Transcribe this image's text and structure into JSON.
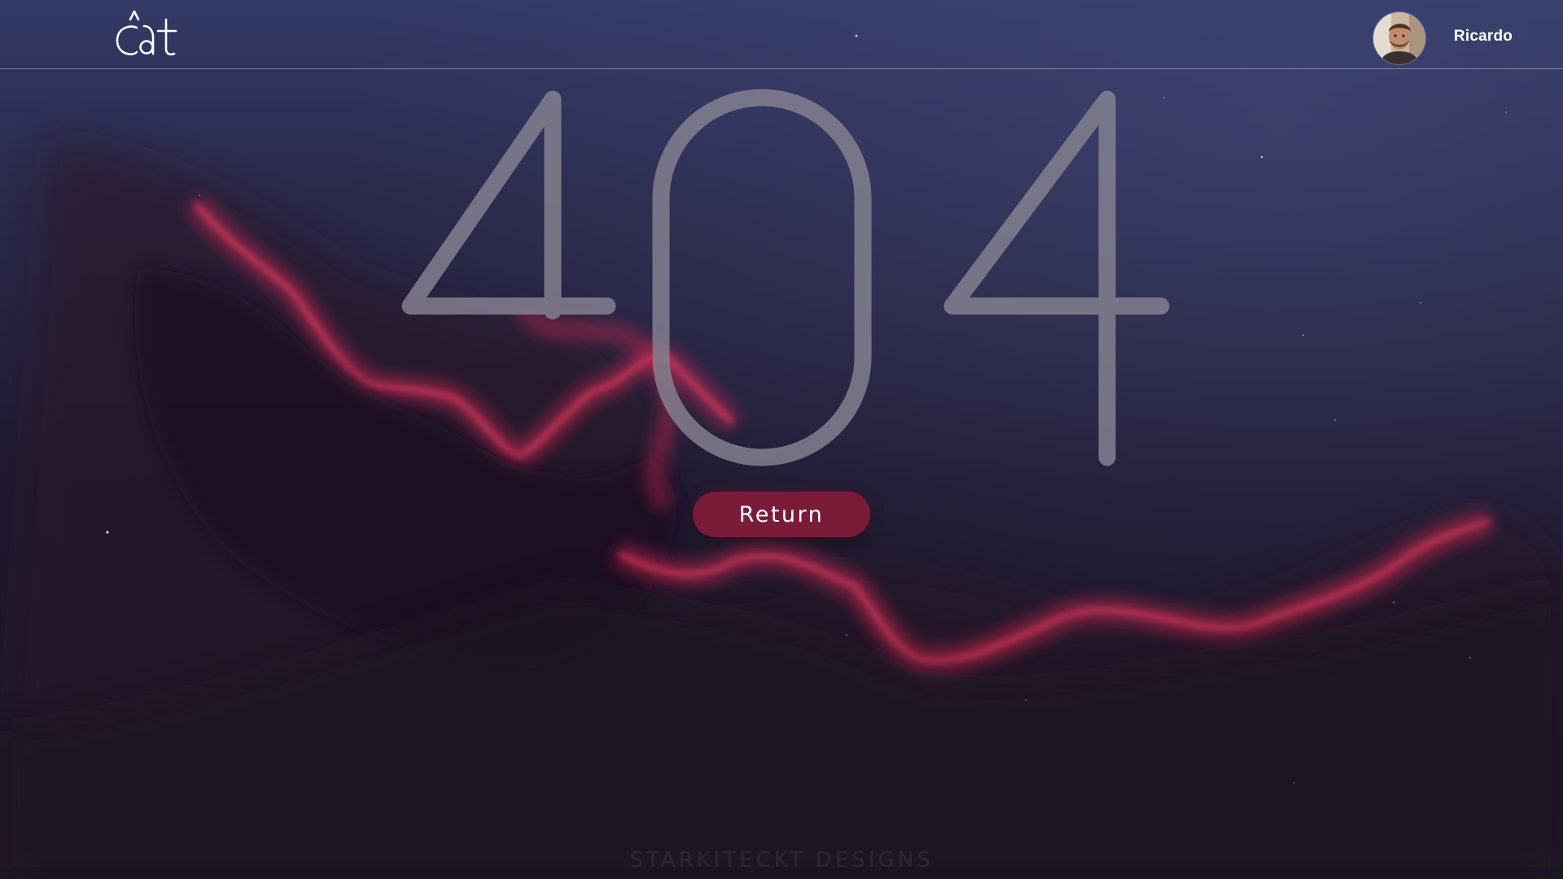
{
  "header": {
    "logo_text": "cat",
    "user": {
      "name": "Ricardo"
    }
  },
  "main": {
    "error_code": "404",
    "return_label": "Return"
  },
  "background": {
    "watermark": "STARKITECKT DESIGNS"
  },
  "colors": {
    "sky_top": "#343a66",
    "sky_bottom": "#1a1526",
    "nebula": "#d8294f",
    "button": "#7a1c37",
    "digits": "#7a7687"
  }
}
